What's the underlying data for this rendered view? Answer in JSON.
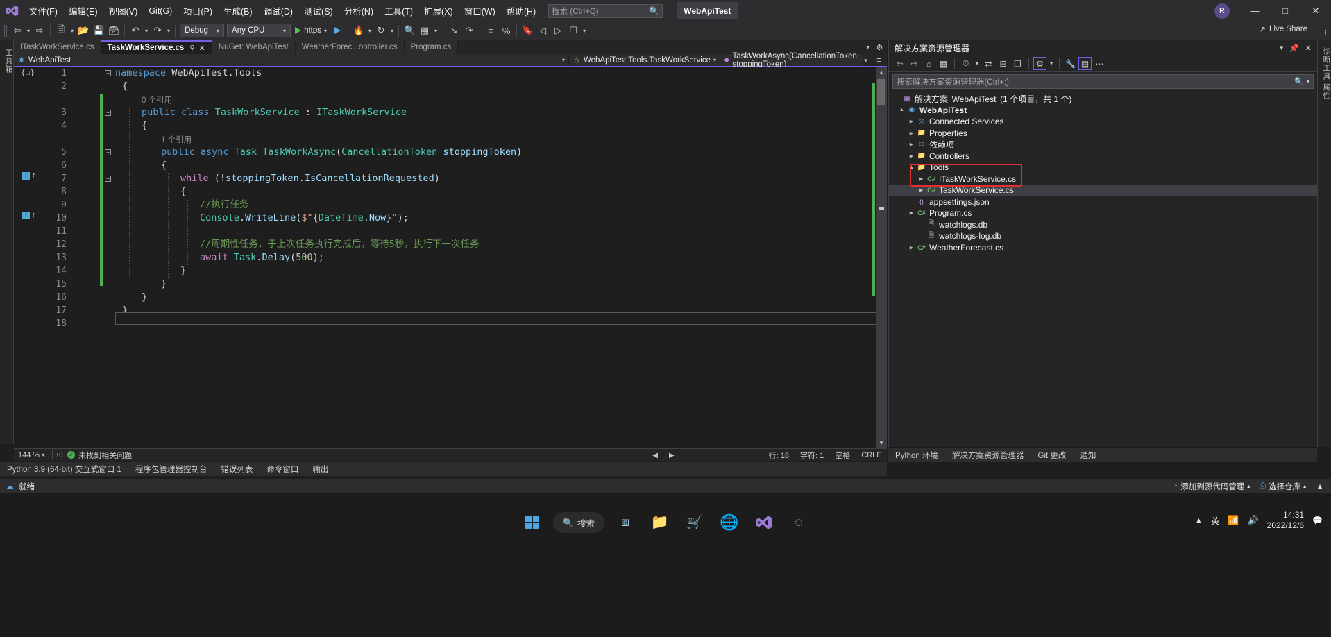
{
  "titlebar": {
    "menus": [
      "文件(F)",
      "编辑(E)",
      "视图(V)",
      "Git(G)",
      "项目(P)",
      "生成(B)",
      "调试(D)",
      "测试(S)",
      "分析(N)",
      "工具(T)",
      "扩展(X)",
      "窗口(W)",
      "帮助(H)"
    ],
    "search_placeholder": "搜索 (Ctrl+Q)",
    "project_chip": "WebApiTest",
    "account_initial": "R",
    "minimize": "—",
    "maximize": "□",
    "close": "✕"
  },
  "toolbar": {
    "config": "Debug",
    "platform": "Any CPU",
    "run_label": "https",
    "live_share": "Live Share",
    "overflow": "⁝"
  },
  "left_dock": {
    "label": "工具箱"
  },
  "tabs": [
    {
      "label": "ITaskWorkService.cs",
      "active": false
    },
    {
      "label": "TaskWorkService.cs",
      "active": true,
      "pin": "⚲",
      "close": "✕"
    },
    {
      "label": "NuGet: WebApiTest",
      "active": false
    },
    {
      "label": "WeatherForec...ontroller.cs",
      "active": false
    },
    {
      "label": "Program.cs",
      "active": false
    }
  ],
  "navbar": {
    "project": "WebApiTest",
    "type": "WebApiTest.Tools.TaskWorkService",
    "member": "TaskWorkAsync(CancellationToken stoppingToken)"
  },
  "editor": {
    "lines": [
      {
        "n": "1",
        "text": "namespace WebApiTest.Tools"
      },
      {
        "n": "2",
        "text": "{"
      },
      {
        "n": "3",
        "text": "public class TaskWorkService : ITaskWorkService",
        "lens": "0 个引用"
      },
      {
        "n": "4",
        "text": "{"
      },
      {
        "n": "5",
        "text": "public async Task TaskWorkAsync(CancellationToken stoppingToken)",
        "lens": "1 个引用"
      },
      {
        "n": "6",
        "text": "{"
      },
      {
        "n": "7",
        "text": "while (!stoppingToken.IsCancellationRequested)"
      },
      {
        "n": "8",
        "text": "{"
      },
      {
        "n": "9",
        "text": "//执行任务"
      },
      {
        "n": "10",
        "text": "Console.WriteLine($\"{DateTime.Now}\");"
      },
      {
        "n": "11",
        "text": ""
      },
      {
        "n": "12",
        "text": "//周期性任务，于上次任务执行完成后，等待5秒，执行下一次任务"
      },
      {
        "n": "13",
        "text": "await Task.Delay(500);"
      },
      {
        "n": "14",
        "text": "}"
      },
      {
        "n": "15",
        "text": "}"
      },
      {
        "n": "16",
        "text": "}"
      },
      {
        "n": "17",
        "text": "}"
      },
      {
        "n": "18",
        "text": ""
      }
    ]
  },
  "editor_status": {
    "zoom": "144 %",
    "issue_status": "未找到相关问题",
    "line": "行: 18",
    "column": "字符: 1",
    "spaces": "空格",
    "eol": "CRLF"
  },
  "bottom_tabs": [
    "Python 3.9 (64-bit) 交互式窗口 1",
    "程序包管理器控制台",
    "错误列表",
    "命令窗口",
    "输出"
  ],
  "solution_explorer": {
    "title": "解决方案资源管理器",
    "search_placeholder": "搜索解决方案资源管理器(Ctrl+;)",
    "tree": [
      {
        "label": "解决方案 'WebApiTest' (1 个项目，共 1 个)",
        "indent": 0,
        "icon": "solution",
        "twisty": "",
        "bold": false,
        "selected": false
      },
      {
        "label": "WebApiTest",
        "indent": 1,
        "icon": "project",
        "twisty": "▲",
        "bold": true,
        "selected": false
      },
      {
        "label": "Connected Services",
        "indent": 2,
        "icon": "services",
        "twisty": "▶",
        "bold": false,
        "selected": false
      },
      {
        "label": "Properties",
        "indent": 2,
        "icon": "props",
        "twisty": "▶",
        "bold": false,
        "selected": false
      },
      {
        "label": "依赖项",
        "indent": 2,
        "icon": "deps",
        "twisty": "▶",
        "bold": false,
        "selected": false
      },
      {
        "label": "Controllers",
        "indent": 2,
        "icon": "folder",
        "twisty": "▶",
        "bold": false,
        "selected": false
      },
      {
        "label": "Tools",
        "indent": 2,
        "icon": "folder",
        "twisty": "▲",
        "bold": false,
        "selected": false
      },
      {
        "label": "ITaskWorkService.cs",
        "indent": 3,
        "icon": "cs",
        "twisty": "▶",
        "bold": false,
        "selected": false
      },
      {
        "label": "TaskWorkService.cs",
        "indent": 3,
        "icon": "cs",
        "twisty": "▶",
        "bold": false,
        "selected": true
      },
      {
        "label": "appsettings.json",
        "indent": 2,
        "icon": "json",
        "twisty": "",
        "bold": false,
        "selected": false
      },
      {
        "label": "Program.cs",
        "indent": 2,
        "icon": "cs",
        "twisty": "▶",
        "bold": false,
        "selected": false
      },
      {
        "label": "watchlogs.db",
        "indent": 2,
        "icon": "db",
        "twisty": "",
        "bold": false,
        "selected": false
      },
      {
        "label": "watchlogs-log.db",
        "indent": 2,
        "icon": "db",
        "twisty": "",
        "bold": false,
        "selected": false
      },
      {
        "label": "WeatherForecast.cs",
        "indent": 2,
        "icon": "cs",
        "twisty": "▶",
        "bold": false,
        "selected": false
      }
    ],
    "right_dock": "诊断工具  属性",
    "bottom_tabs": [
      "Python 环境",
      "解决方案资源管理器",
      "Git 更改",
      "通知"
    ]
  },
  "vs_status": {
    "ready": "就绪",
    "add_source_control": "添加到源代码管理",
    "select_repo": "选择仓库"
  },
  "taskbar": {
    "search_label": "搜索",
    "tray_lang": "英",
    "clock_time": "14:31",
    "clock_date": "2022/12/6"
  },
  "colors": {
    "accent": "#7160e8",
    "changebar": "#4caf50",
    "highlight_box": "#e03030"
  }
}
